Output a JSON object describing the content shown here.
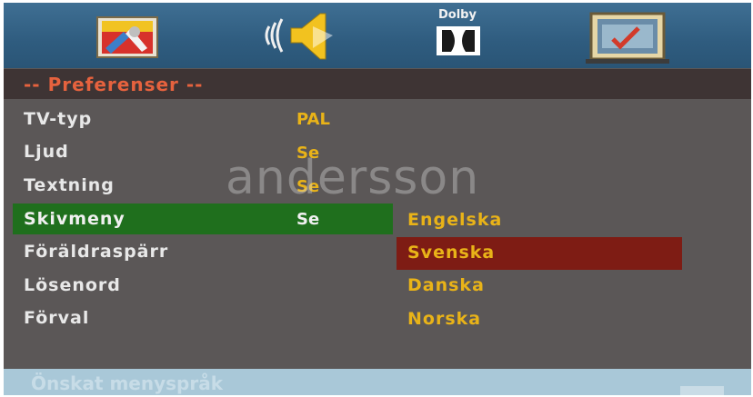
{
  "tabs": [
    {
      "name": "general-setup",
      "icon": "tools-icon"
    },
    {
      "name": "audio-setup",
      "icon": "speaker-icon"
    },
    {
      "name": "dolby-setup",
      "icon": "dolby-icon",
      "label": "Dolby"
    },
    {
      "name": "preferences",
      "icon": "preferences-icon"
    }
  ],
  "header": {
    "title": "-- Preferenser --"
  },
  "rows": [
    {
      "label": "TV-typ",
      "value": "PAL"
    },
    {
      "label": "Ljud",
      "value": "Se"
    },
    {
      "label": "Textning",
      "value": "Se"
    },
    {
      "label": "Skivmeny",
      "value": "Se"
    },
    {
      "label": "Föräldraspärr",
      "value": ""
    },
    {
      "label": "Lösenord",
      "value": ""
    },
    {
      "label": "Förval",
      "value": ""
    }
  ],
  "options": [
    "Engelska",
    "Svenska",
    "Danska",
    "Norska"
  ],
  "watermark": "andersson",
  "footer": {
    "text": "Önskat menyspråk"
  },
  "colors": {
    "background": "#5b5757",
    "topbar": "#2f5c7f",
    "header_title": "#e6623e",
    "value_text": "#e9b318",
    "selected_row": "#1f6f1d",
    "selected_option": "#7e1c14"
  }
}
